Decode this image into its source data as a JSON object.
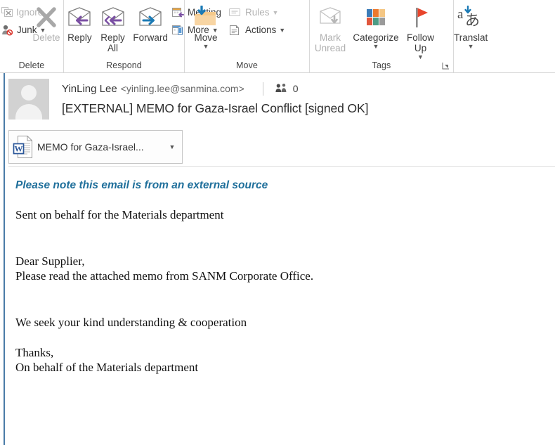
{
  "ribbon": {
    "groups": [
      {
        "name": "delete",
        "label": "Delete",
        "small_buttons": [
          {
            "label": "Ignore",
            "icon": "ignore-icon",
            "disabled": true,
            "caret": false
          },
          {
            "label": "Junk",
            "icon": "junk-icon",
            "disabled": false,
            "caret": true
          }
        ],
        "big_buttons": [
          {
            "label": "Delete",
            "icon": "delete-x-icon",
            "disabled": true,
            "caret": false
          }
        ]
      },
      {
        "name": "respond",
        "label": "Respond",
        "big_buttons": [
          {
            "label": "Reply",
            "icon": "reply-icon"
          },
          {
            "label": "Reply All",
            "icon": "reply-all-icon"
          },
          {
            "label": "Forward",
            "icon": "forward-icon"
          }
        ],
        "small_buttons": [
          {
            "label": "Meeting",
            "icon": "meeting-icon",
            "caret": false
          },
          {
            "label": "More",
            "icon": "more-icon",
            "caret": true
          }
        ]
      },
      {
        "name": "move",
        "label": "Move",
        "big_buttons": [
          {
            "label": "Move",
            "icon": "move-folder-icon",
            "caret": true
          }
        ],
        "small_buttons": [
          {
            "label": "Rules",
            "icon": "rules-icon",
            "disabled": true,
            "caret": true
          },
          {
            "label": "Actions",
            "icon": "actions-icon",
            "disabled": false,
            "caret": true
          }
        ]
      },
      {
        "name": "tags",
        "label": "Tags",
        "has_dialog_launcher": true,
        "big_buttons": [
          {
            "label": "Mark Unread",
            "icon": "mark-unread-icon",
            "disabled": true
          },
          {
            "label": "Categorize",
            "icon": "categorize-icon",
            "caret": true
          },
          {
            "label": "Follow Up",
            "icon": "follow-up-flag-icon",
            "caret": true
          }
        ]
      },
      {
        "name": "language",
        "label": "",
        "big_buttons": [
          {
            "label": "Translat",
            "icon": "translate-icon",
            "caret": true
          }
        ]
      }
    ]
  },
  "message": {
    "sender_name": "YinLing Lee",
    "sender_email": "<yinling.lee@sanmina.com>",
    "people_icon": "people-icon",
    "people_count": "0",
    "subject": "[EXTERNAL] MEMO for Gaza-Israel Conflict [signed OK]",
    "attachment": {
      "name": "MEMO for  Gaza-Israel...",
      "icon": "word-doc-icon"
    },
    "body": {
      "external_notice": "Please note this email is from an external source",
      "line_sent_on_behalf": "Sent on behalf for the Materials department",
      "line_salutation": "Dear Supplier,",
      "line_read_memo": "Please read the attached memo from SANM Corporate Office.",
      "line_cooperation": "We seek your kind understanding & cooperation",
      "line_thanks": "Thanks,",
      "line_signoff": "On behalf of the Materials department"
    }
  },
  "colors": {
    "accent_blue": "#4a7ca8",
    "external_notice": "#1f6f9b",
    "purple_arrow": "#7a4fa3",
    "blue_arrow": "#1b7ab5",
    "flag_red": "#e8452c",
    "folder_tan": "#f5c98a",
    "word_blue": "#2a5699"
  }
}
